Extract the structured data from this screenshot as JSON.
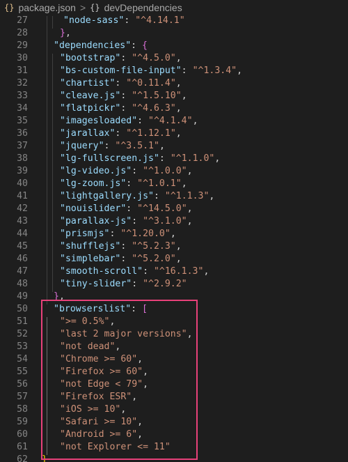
{
  "breadcrumb": {
    "file_icon": "{}",
    "file_name": "package.json",
    "separator": ">",
    "symbol_icon": "{}",
    "symbol_name": "devDependencies"
  },
  "icons": {
    "file_icon": "json-file-icon",
    "separator": "chevron-right-icon",
    "symbol_icon": "object-symbol-icon"
  },
  "colors": {
    "background": "#1e1e1e",
    "property_key": "#9cdcfe",
    "string_value": "#ce9178",
    "bracket_level_1": "#da70d6",
    "bracket_level_2": "#ffd700",
    "line_number": "#858585",
    "highlight_box": "#e8417a"
  },
  "code_lines": [
    {
      "num": "27",
      "indent": 2,
      "key": "\"node-sass\"",
      "value": "\"^4.14.1\""
    },
    {
      "num": "28",
      "indent": 1,
      "close": "}",
      "close_class": "b1",
      "comma": ","
    },
    {
      "num": "29",
      "indent": 0,
      "key": "\"dependencies\"",
      "open": "{",
      "open_class": "b1"
    },
    {
      "num": "30",
      "indent": 1,
      "key": "\"bootstrap\"",
      "value": "\"^4.5.0\"",
      "comma": ","
    },
    {
      "num": "31",
      "indent": 1,
      "key": "\"bs-custom-file-input\"",
      "value": "\"^1.3.4\"",
      "comma": ","
    },
    {
      "num": "32",
      "indent": 1,
      "key": "\"chartist\"",
      "value": "\"^0.11.4\"",
      "comma": ","
    },
    {
      "num": "33",
      "indent": 1,
      "key": "\"cleave.js\"",
      "value": "\"^1.5.10\"",
      "comma": ","
    },
    {
      "num": "34",
      "indent": 1,
      "key": "\"flatpickr\"",
      "value": "\"^4.6.3\"",
      "comma": ","
    },
    {
      "num": "35",
      "indent": 1,
      "key": "\"imagesloaded\"",
      "value": "\"^4.1.4\"",
      "comma": ","
    },
    {
      "num": "36",
      "indent": 1,
      "key": "\"jarallax\"",
      "value": "\"^1.12.1\"",
      "comma": ","
    },
    {
      "num": "37",
      "indent": 1,
      "key": "\"jquery\"",
      "value": "\"^3.5.1\"",
      "comma": ","
    },
    {
      "num": "38",
      "indent": 1,
      "key": "\"lg-fullscreen.js\"",
      "value": "\"^1.1.0\"",
      "comma": ","
    },
    {
      "num": "39",
      "indent": 1,
      "key": "\"lg-video.js\"",
      "value": "\"^1.0.0\"",
      "comma": ","
    },
    {
      "num": "40",
      "indent": 1,
      "key": "\"lg-zoom.js\"",
      "value": "\"^1.0.1\"",
      "comma": ","
    },
    {
      "num": "41",
      "indent": 1,
      "key": "\"lightgallery.js\"",
      "value": "\"^1.1.3\"",
      "comma": ","
    },
    {
      "num": "42",
      "indent": 1,
      "key": "\"nouislider\"",
      "value": "\"^14.5.0\"",
      "comma": ","
    },
    {
      "num": "43",
      "indent": 1,
      "key": "\"parallax-js\"",
      "value": "\"^3.1.0\"",
      "comma": ","
    },
    {
      "num": "44",
      "indent": 1,
      "key": "\"prismjs\"",
      "value": "\"^1.20.0\"",
      "comma": ","
    },
    {
      "num": "45",
      "indent": 1,
      "key": "\"shufflejs\"",
      "value": "\"^5.2.3\"",
      "comma": ","
    },
    {
      "num": "46",
      "indent": 1,
      "key": "\"simplebar\"",
      "value": "\"^5.2.0\"",
      "comma": ","
    },
    {
      "num": "47",
      "indent": 1,
      "key": "\"smooth-scroll\"",
      "value": "\"^16.1.3\"",
      "comma": ","
    },
    {
      "num": "48",
      "indent": 1,
      "key": "\"tiny-slider\"",
      "value": "\"^2.9.2\""
    },
    {
      "num": "49",
      "indent": 0,
      "close": "}",
      "close_class": "b1",
      "comma": ","
    },
    {
      "num": "50",
      "indent": 0,
      "key": "\"browserslist\"",
      "open": "[",
      "open_class": "b1"
    },
    {
      "num": "51",
      "indent": 1,
      "value": "\">= 0.5%\"",
      "comma": ","
    },
    {
      "num": "52",
      "indent": 1,
      "value": "\"last 2 major versions\"",
      "comma": ","
    },
    {
      "num": "53",
      "indent": 1,
      "value": "\"not dead\"",
      "comma": ","
    },
    {
      "num": "54",
      "indent": 1,
      "value": "\"Chrome >= 60\"",
      "comma": ","
    },
    {
      "num": "55",
      "indent": 1,
      "value": "\"Firefox >= 60\"",
      "comma": ","
    },
    {
      "num": "56",
      "indent": 1,
      "value": "\"not Edge < 79\"",
      "comma": ","
    },
    {
      "num": "57",
      "indent": 1,
      "value": "\"Firefox ESR\"",
      "comma": ","
    },
    {
      "num": "58",
      "indent": 1,
      "value": "\"iOS >= 10\"",
      "comma": ","
    },
    {
      "num": "59",
      "indent": 1,
      "value": "\"Safari >= 10\"",
      "comma": ","
    },
    {
      "num": "60",
      "indent": 1,
      "value": "\"Android >= 6\"",
      "comma": ","
    },
    {
      "num": "61",
      "indent": 1,
      "value": "\"not Explorer <= 11\""
    },
    {
      "num": "62",
      "indent": -1,
      "close": "}",
      "close_class": "b2"
    }
  ]
}
